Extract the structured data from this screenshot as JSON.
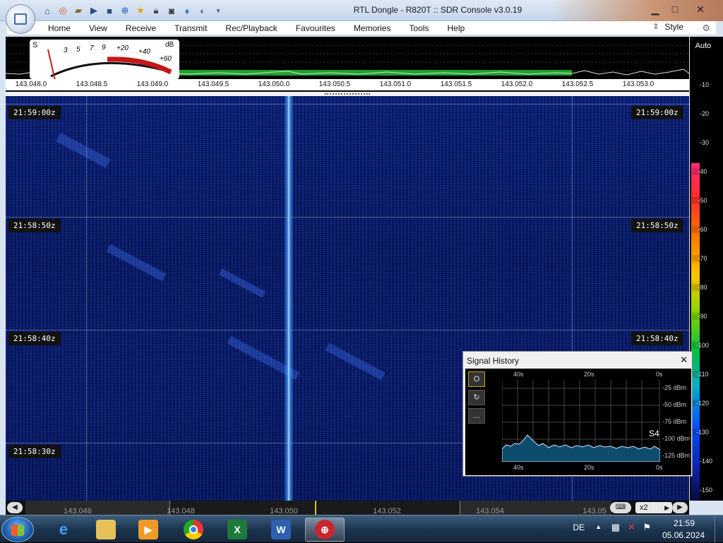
{
  "window": {
    "title": "RTL Dongle - R820T :: SDR Console v3.0.19"
  },
  "quick_access": [
    "home-icon",
    "lifebuoy-icon",
    "folder-icon",
    "play-icon",
    "stop-icon",
    "plus-icon",
    "star-icon",
    "lock-icon",
    "camera-icon",
    "drop-icon",
    "mouse-icon",
    "dropdown-icon"
  ],
  "menu": {
    "items": [
      "Home",
      "View",
      "Receive",
      "Transmit",
      "Rec/Playback",
      "Favourites",
      "Memories",
      "Tools",
      "Help"
    ],
    "style_label": "Style"
  },
  "smeter": {
    "s_label": "S",
    "scale_labels": [
      "3",
      "5",
      "7",
      "9",
      "+20",
      "+40",
      "+60"
    ],
    "unit": "dB"
  },
  "freq_axis": [
    "143.048.0",
    "143.048.5",
    "143.049.0",
    "143.049.5",
    "143.050.0",
    "143.050.5",
    "143.051.0",
    "143.051.5",
    "143.052.0",
    "143.052.5",
    "143.053.0"
  ],
  "level_scale": {
    "auto_label": "Auto",
    "ticks": [
      "-10",
      "-20",
      "-30",
      "-40",
      "-50",
      "-60",
      "-70",
      "-80",
      "-90",
      "-100",
      "-110",
      "-120",
      "-130",
      "-140",
      "-150"
    ]
  },
  "waterfall": {
    "timestamps": [
      "21:59:00z",
      "21:58:50z",
      "21:58:40z",
      "21:58:30z"
    ]
  },
  "bottom_axis": [
    "143.046",
    "143.048",
    "143.050",
    "143.052",
    "143.054",
    "143.05"
  ],
  "zoom": {
    "label": "x2"
  },
  "signal_history": {
    "title": "Signal History",
    "top_labels": [
      "40s",
      "20s",
      "0s"
    ],
    "bottom_labels": [
      "40s",
      "20s",
      "0s"
    ],
    "db_labels": [
      "-25 dBm",
      "-50 dBm",
      "-75 dBm",
      "-100 dBm",
      "-125 dBm"
    ],
    "s_reading": "S4",
    "tools": [
      "O",
      "↻",
      "…"
    ]
  },
  "taskbar": {
    "apps": [
      "ie",
      "explorer",
      "media",
      "chrome",
      "excel",
      "word",
      "sdr-console"
    ],
    "language": "DE",
    "time": "21:59",
    "date": "05.06.2024"
  },
  "colors": {
    "waterfall_bg": "#0c1f6b",
    "trace": "#4aa0ff",
    "spectrum_green": "#1fa22e"
  }
}
